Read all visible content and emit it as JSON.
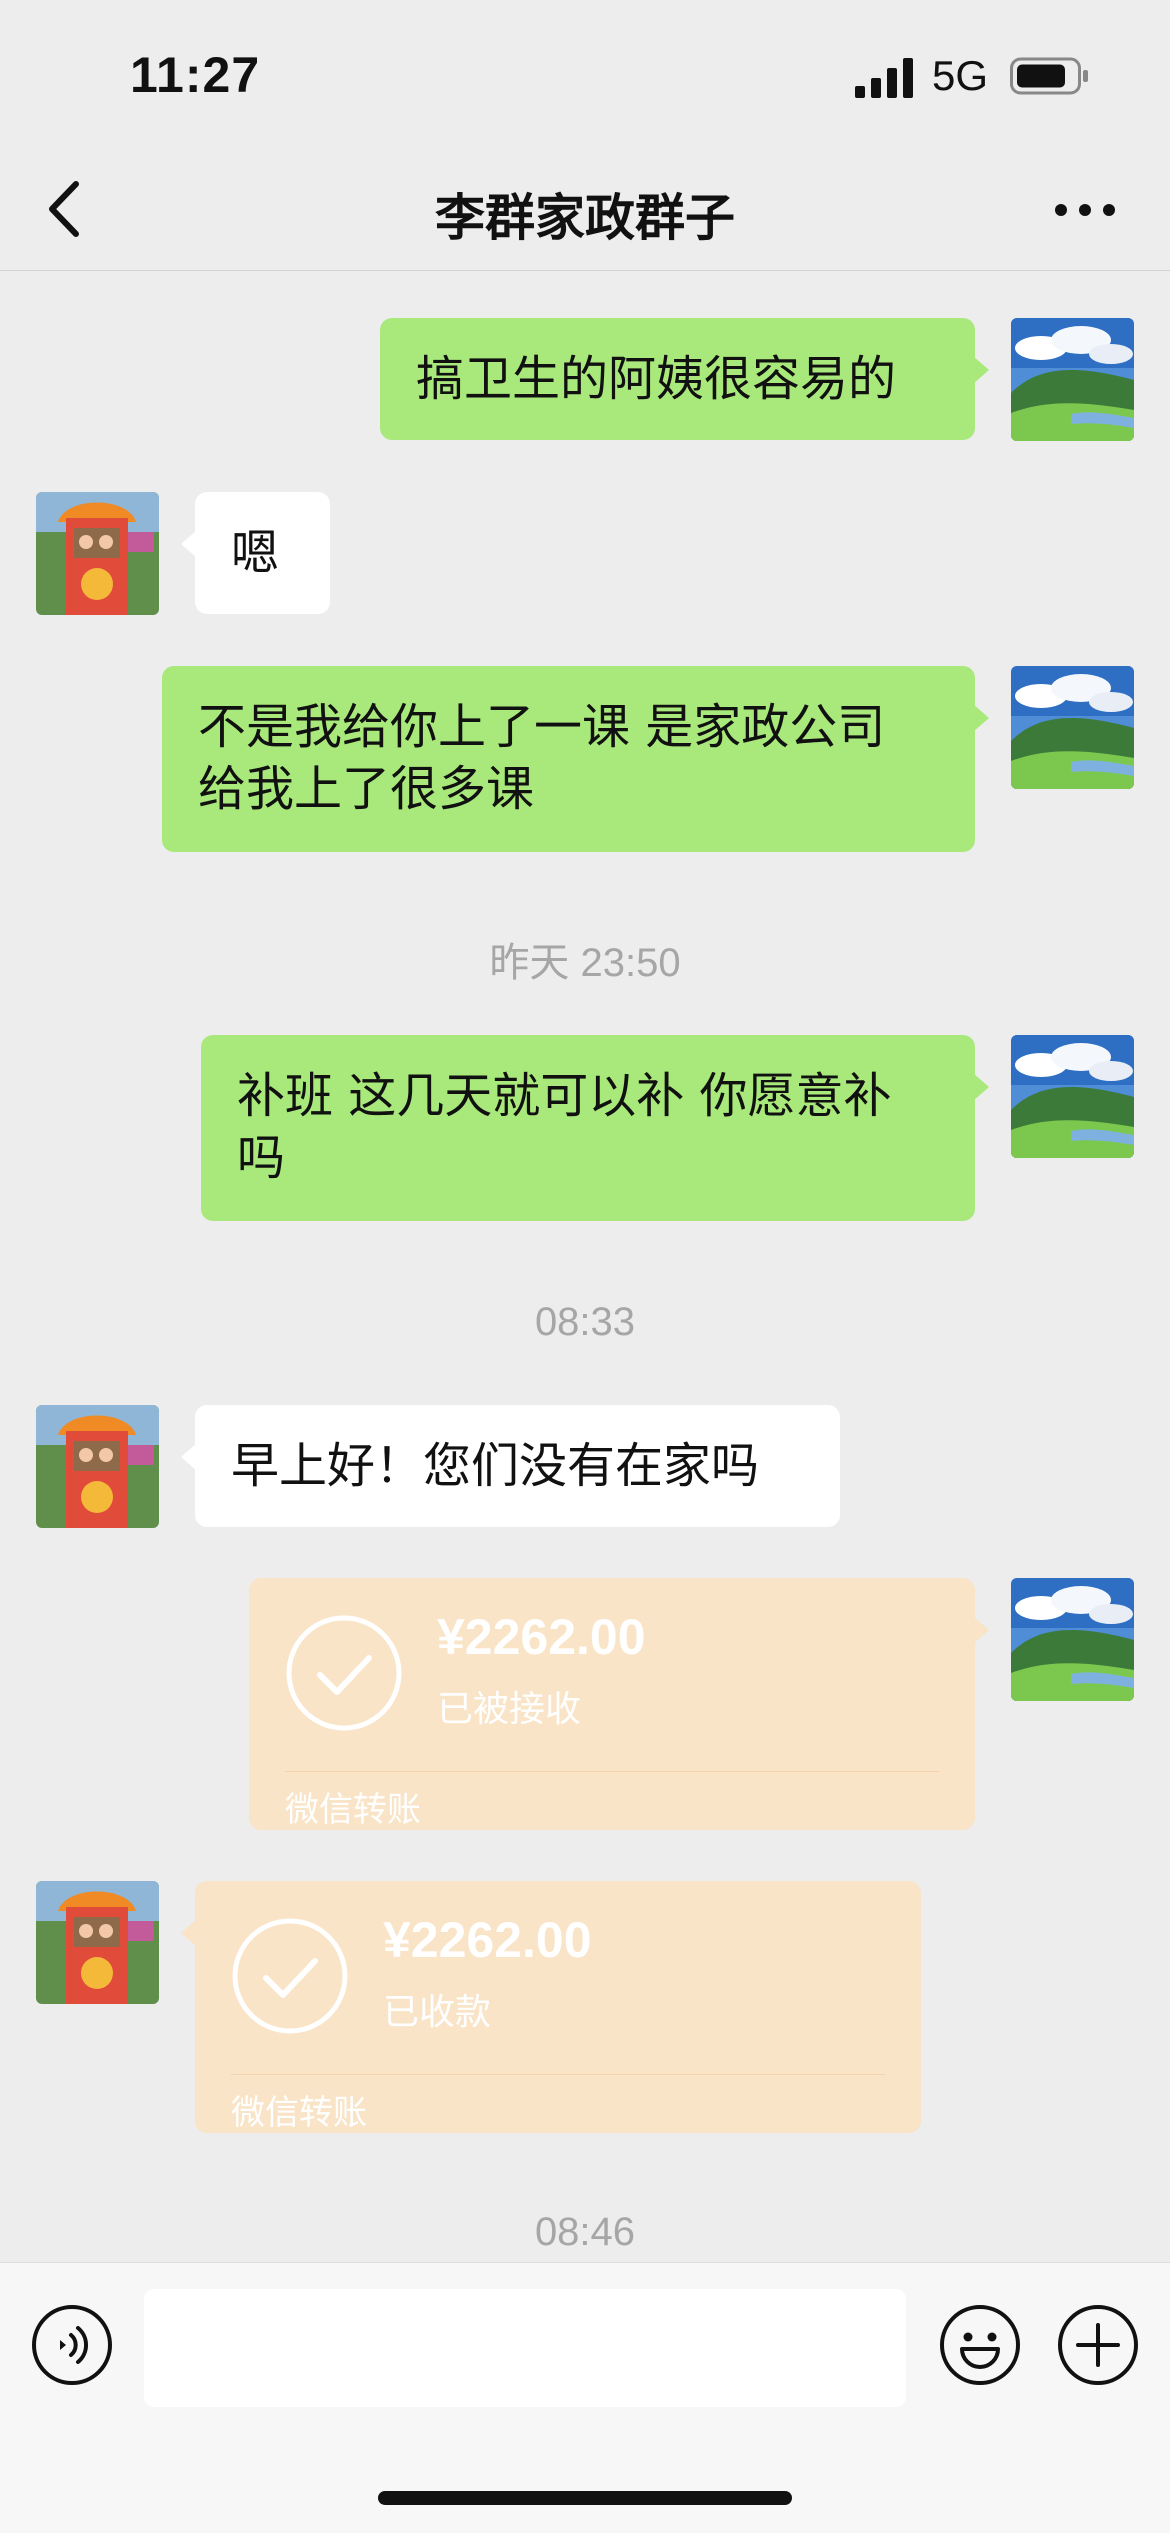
{
  "status_bar": {
    "time": "11:27",
    "network": "5G"
  },
  "chat": {
    "title": "李群家政群子"
  },
  "messages": {
    "m1": {
      "text": "搞卫生的阿姨很容易的"
    },
    "m2": {
      "text": "嗯"
    },
    "m3": {
      "line1": "不是我给你上了一课 是家政公司",
      "line2": "给我上了很多课"
    },
    "ts1": "昨天 23:50",
    "m4": {
      "line1": "补班 这几天就可以补 你愿意补",
      "line2": "吗"
    },
    "ts2": "08:33",
    "m5": {
      "text": "早上好！您们没有在家吗"
    },
    "t1": {
      "amount": "¥2262.00",
      "status": "已被接收",
      "label": "微信转账"
    },
    "t2": {
      "amount": "¥2262.00",
      "status": "已收款",
      "label": "微信转账"
    },
    "ts3": "08:46"
  },
  "icons": {
    "back": "chevron-left-icon",
    "more": "more-dots-icon",
    "voice": "voice-icon",
    "emoji": "emoji-icon",
    "plus": "plus-icon",
    "check": "check-circle-icon"
  },
  "colors": {
    "chat_background": "#ededed",
    "my_bubble": "#a9e97b",
    "other_bubble": "#ffffff",
    "transfer_card": "#f9e4c7",
    "timestamp_text": "#a6a6a6"
  }
}
